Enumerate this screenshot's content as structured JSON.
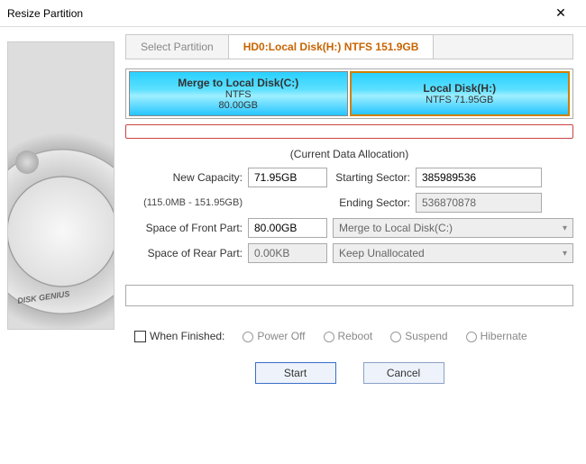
{
  "window": {
    "title": "Resize Partition"
  },
  "tabs": {
    "select": "Select Partition",
    "current": "HD0:Local Disk(H:) NTFS 151.9GB"
  },
  "partitions": [
    {
      "name": "Merge to Local Disk(C:)",
      "fs": "NTFS",
      "size": "80.00GB"
    },
    {
      "name": "Local Disk(H:)",
      "fs_size": "NTFS 71.95GB"
    }
  ],
  "alloc_label": "(Current Data Allocation)",
  "fields": {
    "new_capacity_label": "New Capacity:",
    "new_capacity": "71.95GB",
    "range_hint": "(115.0MB - 151.95GB)",
    "start_sector_label": "Starting Sector:",
    "start_sector": "385989536",
    "end_sector_label": "Ending Sector:",
    "end_sector": "536870878",
    "front_label": "Space of Front Part:",
    "front_value": "80.00GB",
    "front_target": "Merge to Local Disk(C:)",
    "rear_label": "Space of Rear Part:",
    "rear_value": "0.00KB",
    "rear_target": "Keep Unallocated"
  },
  "finish": {
    "label": "When Finished:",
    "opts": [
      "Power Off",
      "Reboot",
      "Suspend",
      "Hibernate"
    ]
  },
  "buttons": {
    "start": "Start",
    "cancel": "Cancel"
  }
}
